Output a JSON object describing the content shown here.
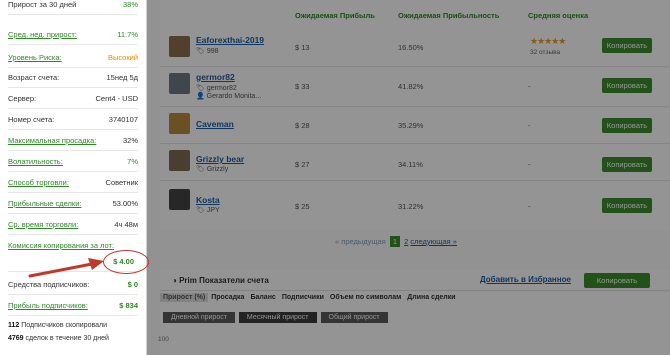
{
  "columns": {
    "expected_profit": "Ожидаемая Прибыль",
    "expected_profitability": "Ожидаемая Прибыльность",
    "avg_rating": "Средняя оценка"
  },
  "traders": [
    {
      "name": "Eaforexthai-2019",
      "sub": "998",
      "sub2": "",
      "profit": "$ 13",
      "pct": "16.50%",
      "rating": "★★★★★",
      "votes": "32 отзыва",
      "copy": "Копировать",
      "flag_color": "#b2282e"
    },
    {
      "name": "germor82",
      "sub": "germor82",
      "sub2": "Gerardo Monita...",
      "profit": "$ 33",
      "pct": "41.82%",
      "rating": "-",
      "votes": "",
      "copy": "Копировать",
      "flag_color": "#2d5d9e"
    },
    {
      "name": "Caveman",
      "sub": "",
      "sub2": "",
      "profit": "$ 28",
      "pct": "35.29%",
      "rating": "-",
      "votes": "",
      "copy": "Копировать",
      "flag_color": "#c14a2c"
    },
    {
      "name": "Grizzly bear",
      "sub": "Grizzly",
      "sub2": "",
      "profit": "$ 27",
      "pct": "34.11%",
      "rating": "-",
      "votes": "",
      "copy": "Копировать",
      "flag_color": "#6b5a3a"
    },
    {
      "name": "Kosta",
      "sub": "JPY",
      "sub2": "",
      "profit": "$ 25",
      "pct": "31.22%",
      "rating": "-",
      "votes": "",
      "copy": "Копировать",
      "flag_color": "#333333"
    }
  ],
  "pager": {
    "prev": "« предыдущая",
    "page1": "1",
    "page2": "2",
    "next": "следующая »"
  },
  "section": {
    "title": "Prim Показатели счета",
    "favorite": "Добавить в Избранное",
    "copy": "Копировать",
    "tabs": [
      "Прирост (%)",
      "Просадка",
      "Баланс",
      "Подписчики",
      "Объем по символам",
      "Длина сделки"
    ],
    "subtabs": [
      "Дневной прирост",
      "Месячный прирост",
      "Общий прирост"
    ],
    "y_tick": "100"
  },
  "panel": {
    "rows": [
      {
        "label": "Прирост за 30 дней",
        "value": "38%",
        "link": false,
        "style": "green"
      },
      {
        "label": "Сред. нед. прирост:",
        "value": "11.7%",
        "link": true,
        "style": "green"
      },
      {
        "label": "Уровень Риска:",
        "value": "Высокий",
        "link": true,
        "style": "orange"
      },
      {
        "label": "Возраст счета:",
        "value": "15нед 5д",
        "link": false,
        "style": ""
      },
      {
        "label": "Сервер:",
        "value": "Cent4 - USD",
        "link": false,
        "style": ""
      },
      {
        "label": "Номер счета:",
        "value": "3740107",
        "link": false,
        "style": ""
      },
      {
        "label": "Максимальная просадка:",
        "value": "32%",
        "link": true,
        "style": ""
      },
      {
        "label": "Волатильность:",
        "value": "7%",
        "link": true,
        "style": "green"
      },
      {
        "label": "Способ торговли:",
        "value": "Советник",
        "link": true,
        "style": ""
      },
      {
        "label": "Прибыльные сделки:",
        "value": "53.00%",
        "link": true,
        "style": ""
      },
      {
        "label": "Ср. время торговли:",
        "value": "4ч 48м",
        "link": true,
        "style": ""
      },
      {
        "label": "Комиссия копирования за лот:",
        "value": "",
        "link": true,
        "style": ""
      },
      {
        "label": "",
        "value": "$ 4.00",
        "link": false,
        "style": "green"
      },
      {
        "label": "Средства подписчиков:",
        "value": "$ 0",
        "link": false,
        "style": "green"
      },
      {
        "label": "Прибыль подписчиков:",
        "value": "$ 834",
        "link": true,
        "style": "green bold"
      }
    ],
    "footer1_num": "112",
    "footer1_text": "Подписчиков скопировали",
    "footer2_num": "4769",
    "footer2_text": "сделок в течение 30 дней"
  },
  "colors": {
    "accent_green": "#3c8e2e",
    "link_blue": "#1d5fa8",
    "highlight_red": "#c0392b"
  }
}
